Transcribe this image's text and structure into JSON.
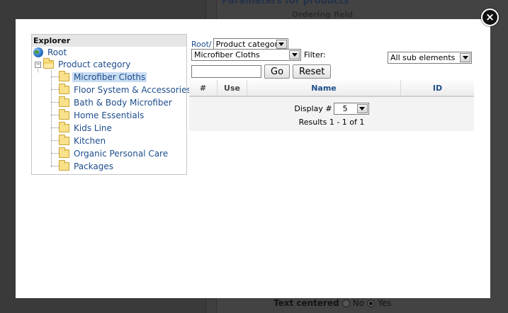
{
  "background": {
    "heading": "Parameters for products",
    "subheading": "Ordering field",
    "text_centered_label": "Text centered",
    "option_no": "No",
    "option_yes": "Yes"
  },
  "modal": {
    "close_symbol": "×",
    "explorer": {
      "title": "Explorer",
      "root_label": "Root",
      "category_label": "Product category",
      "children": [
        "Microfiber Cloths",
        "Floor System & Accessories",
        "Bath & Body Microfiber",
        "Home Essentials",
        "Kids Line",
        "Kitchen",
        "Organic Personal Care",
        "Packages"
      ],
      "selected_index": 0
    },
    "breadcrumb": {
      "root_link": "Root/",
      "category_select": "Product category"
    },
    "filter": {
      "subcategory_select": "Microfiber Cloths",
      "label": "Filter:",
      "scope_select": "All sub elements"
    },
    "search": {
      "value": "",
      "go_label": "Go",
      "reset_label": "Reset"
    },
    "table": {
      "columns": [
        "#",
        "Use",
        "Name",
        "ID"
      ],
      "display_label": "Display #",
      "display_value": "5",
      "results_text": "Results 1 - 1 of 1"
    }
  },
  "colors": {
    "link": "#1e4d8c",
    "selection": "#c8dcf2",
    "overlay": "#3a3a3a"
  }
}
